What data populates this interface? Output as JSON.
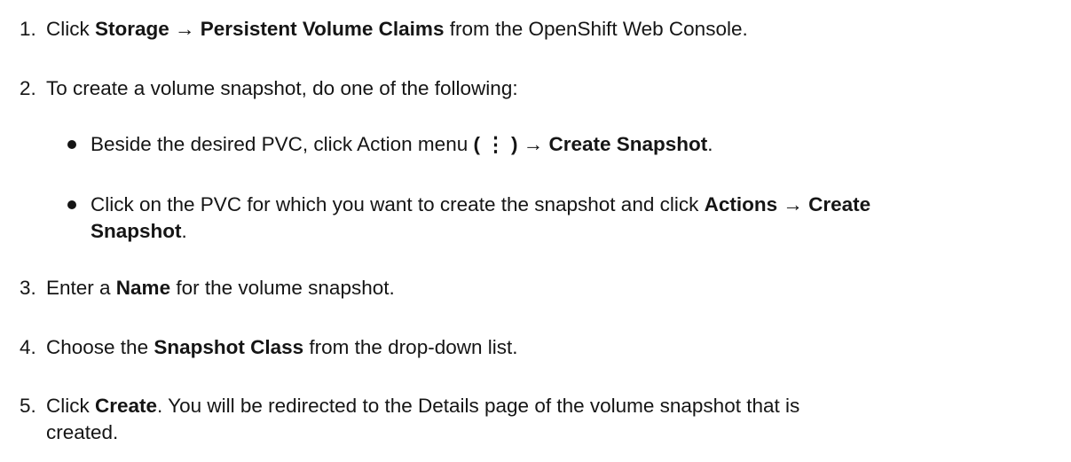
{
  "steps": [
    {
      "num": "1.",
      "parts": {
        "p1": "Click ",
        "b1": "Storage → Persistent Volume Claims",
        "p2": " from the OpenShift Web Console."
      }
    },
    {
      "num": "2.",
      "parts": {
        "p1": "To create a volume snapshot, do one of the following:"
      },
      "bullets": [
        {
          "p1": "Beside the desired PVC, click Action menu ",
          "b1": "( ⋮ ) → Create Snapshot",
          "p2": "."
        },
        {
          "p1": "Click on the PVC for which you want to create the snapshot and click ",
          "b1": "Actions → Create",
          "b2": "Snapshot",
          "p2": "."
        }
      ]
    },
    {
      "num": "3.",
      "parts": {
        "p1": "Enter a ",
        "b1": "Name",
        "p2": " for the volume snapshot."
      }
    },
    {
      "num": "4.",
      "parts": {
        "p1": "Choose the ",
        "b1": "Snapshot Class",
        "p2": " from the drop-down list."
      }
    },
    {
      "num": "5.",
      "parts": {
        "p1": "Click ",
        "b1": "Create",
        "p2": ". You will be redirected to the Details page of the volume snapshot that is",
        "p3": "created."
      }
    }
  ]
}
